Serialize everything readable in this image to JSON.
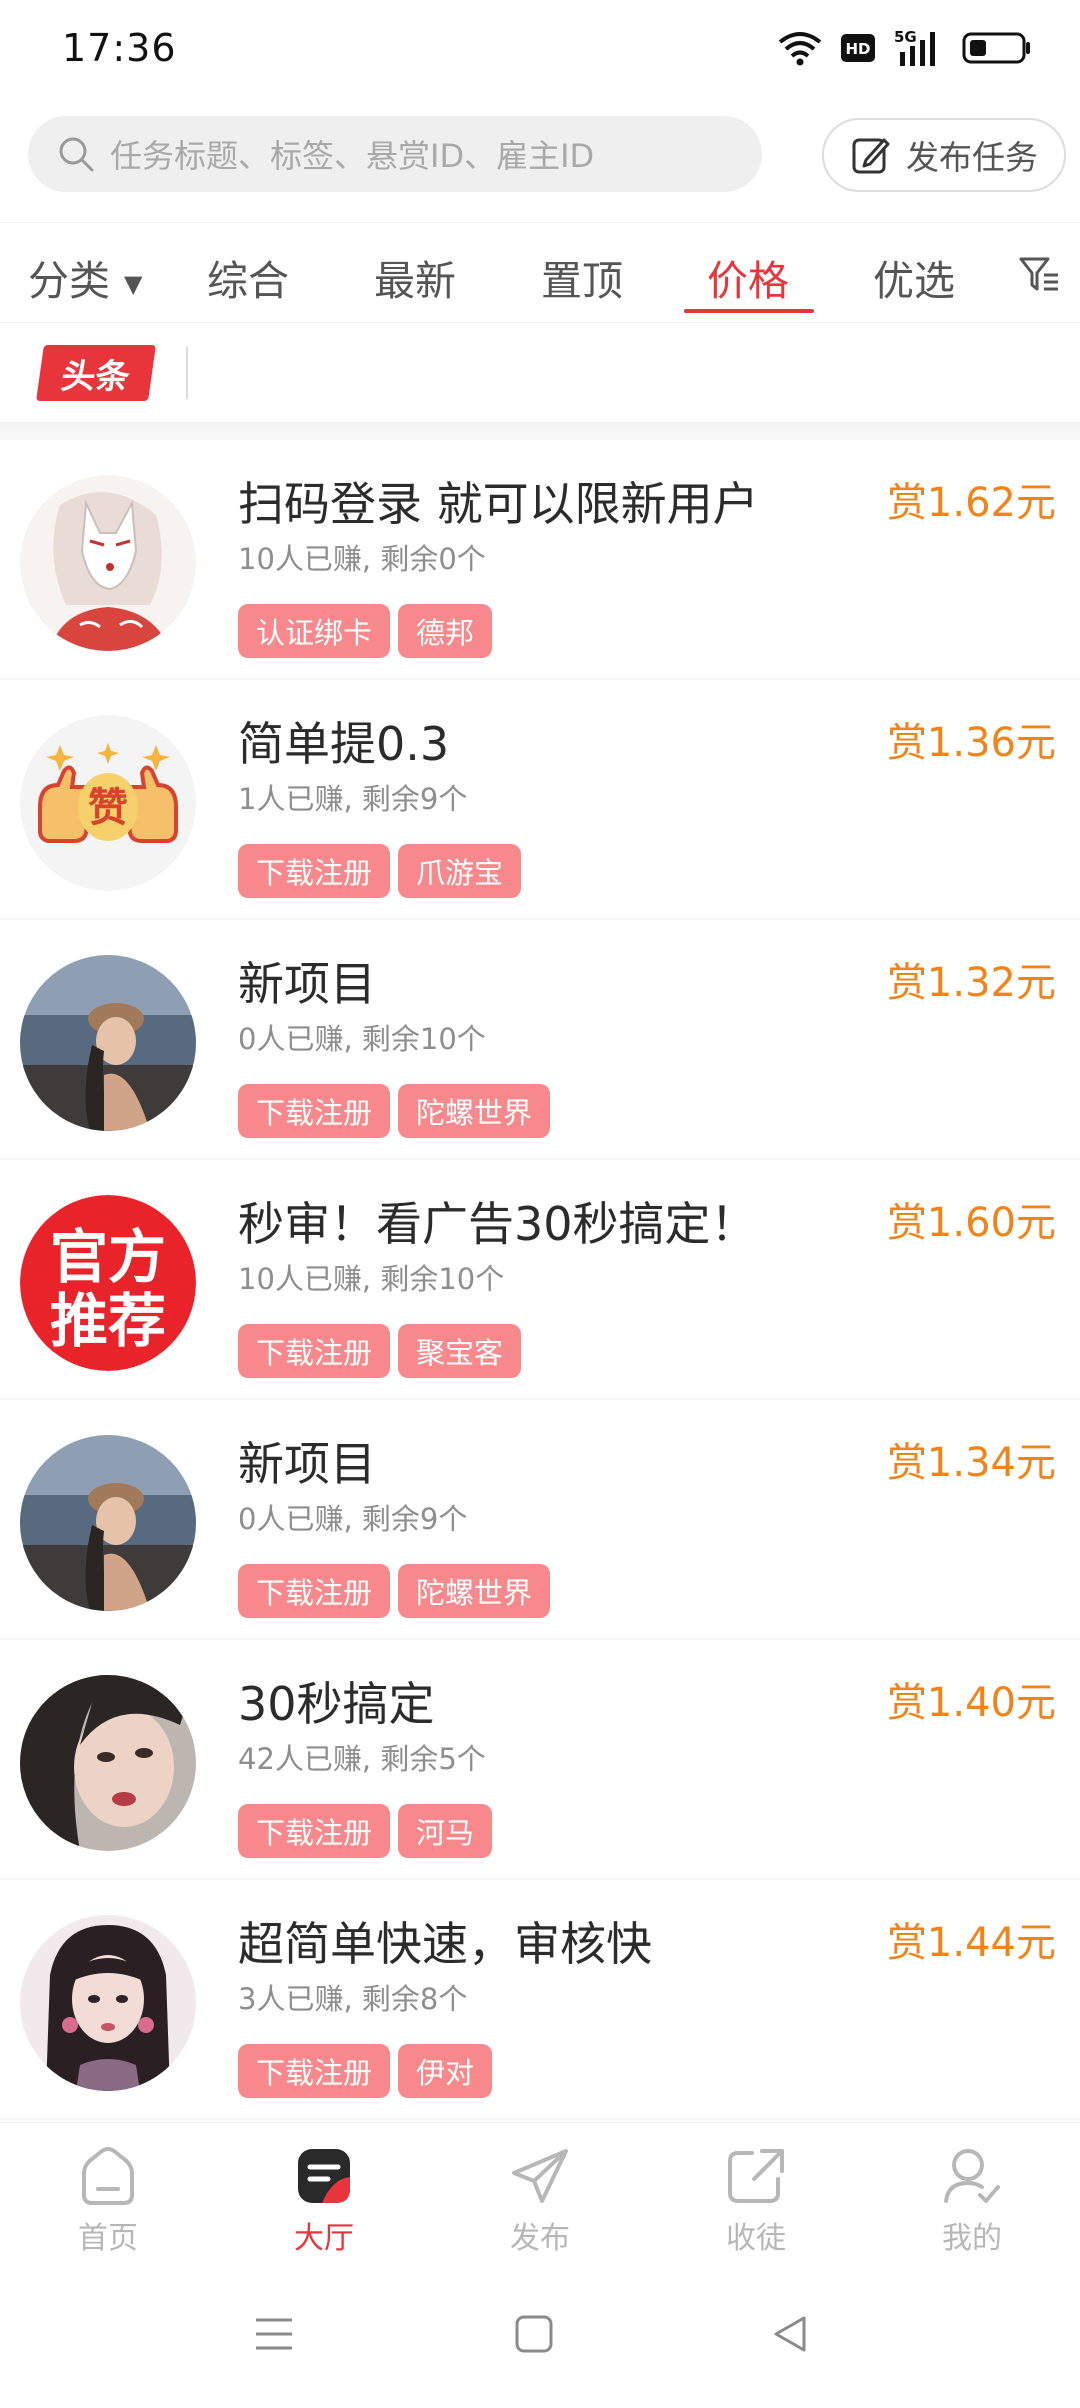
{
  "status_bar": {
    "time": "17:36",
    "icons": [
      "wifi-icon",
      "hd-icon",
      "signal-5g-icon",
      "battery-icon"
    ],
    "hd": "HD",
    "net": "5G"
  },
  "search": {
    "placeholder": "任务标题、标签、悬赏ID、雇主ID"
  },
  "publish_button": {
    "label": "发布任务"
  },
  "tabs": [
    {
      "label": "分类",
      "active": false
    },
    {
      "label": "综合",
      "active": false
    },
    {
      "label": "最新",
      "active": false
    },
    {
      "label": "置顶",
      "active": false
    },
    {
      "label": "价格",
      "active": true
    },
    {
      "label": "优选",
      "active": false
    }
  ],
  "headline": {
    "badge": "头条"
  },
  "tasks": [
    {
      "title": "扫码登录 就可以限新用户",
      "stats": "10人已赚, 剩余0个",
      "reward": "赏1.62元",
      "tags": [
        "认证绑卡",
        "德邦"
      ],
      "avatar": "fox-mask-girl-avatar"
    },
    {
      "title": "简单提0.3",
      "stats": "1人已赚, 剩余9个",
      "reward": "赏1.36元",
      "tags": [
        "下载注册",
        "爪游宝"
      ],
      "avatar": "thumbs-up-zan-avatar",
      "avatar_text": "赞"
    },
    {
      "title": "新项目",
      "stats": "0人已赚, 剩余10个",
      "reward": "赏1.32元",
      "tags": [
        "下载注册",
        "陀螺世界"
      ],
      "avatar": "girl-seaside-avatar"
    },
    {
      "title": "秒审！看广告30秒搞定！",
      "stats": "10人已赚, 剩余10个",
      "reward": "赏1.60元",
      "tags": [
        "下载注册",
        "聚宝客"
      ],
      "avatar": "official-recommend-avatar",
      "avatar_text_1": "官方",
      "avatar_text_2": "推荐"
    },
    {
      "title": "新项目",
      "stats": "0人已赚, 剩余9个",
      "reward": "赏1.34元",
      "tags": [
        "下载注册",
        "陀螺世界"
      ],
      "avatar": "girl-seaside-avatar"
    },
    {
      "title": "30秒搞定",
      "stats": "42人已赚, 剩余5个",
      "reward": "赏1.40元",
      "tags": [
        "下载注册",
        "河马"
      ],
      "avatar": "girl-portrait-avatar"
    },
    {
      "title": "超简单快速，审核快",
      "stats": "3人已赚, 剩余8个",
      "reward": "赏1.44元",
      "tags": [
        "下载注册",
        "伊对"
      ],
      "avatar": "girl-doll-avatar"
    }
  ],
  "bottom_nav": [
    {
      "label": "首页",
      "icon": "home-icon",
      "active": false
    },
    {
      "label": "大厅",
      "icon": "hall-icon",
      "active": true
    },
    {
      "label": "发布",
      "icon": "send-icon",
      "active": false
    },
    {
      "label": "收徒",
      "icon": "share-icon",
      "active": false
    },
    {
      "label": "我的",
      "icon": "profile-icon",
      "active": false
    }
  ],
  "colors": {
    "accent": "#e8343b",
    "reward": "#f08418",
    "tag": "#f7898d",
    "inactive_nav": "#b7b7b7"
  }
}
